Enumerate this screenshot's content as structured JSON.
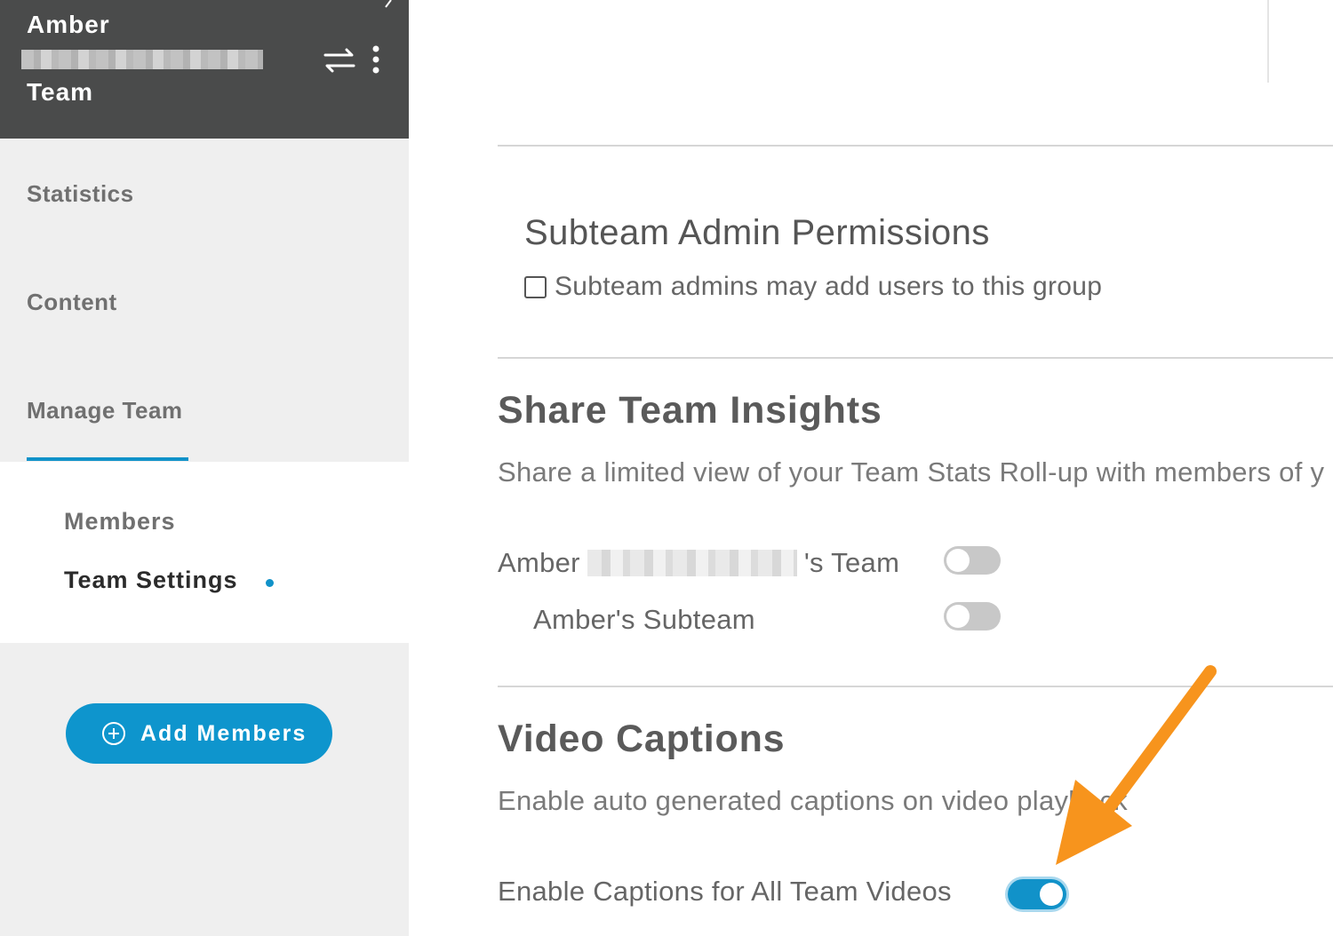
{
  "sidebar": {
    "team_name_line1": "Amber",
    "team_name_line2": "Team",
    "nav": {
      "statistics": "Statistics",
      "content": "Content",
      "manage_team": "Manage Team"
    },
    "subnav": {
      "members": "Members",
      "team_settings": "Team Settings"
    },
    "add_members_label": "Add Members",
    "accent_color": "#1192c9",
    "header_color": "#4a4b4b"
  },
  "main": {
    "subteam_admin": {
      "title": "Subteam Admin Permissions",
      "checkbox_label": "Subteam admins may add users to this group",
      "checked": false
    },
    "share_insights": {
      "title": "Share Team Insights",
      "description": "Share a limited view of your Team Stats Roll-up with members of y",
      "team_toggle": {
        "label_prefix": "Amber",
        "label_suffix": "'s Team",
        "on": false
      },
      "subteam_toggle": {
        "label": "Amber's Subteam",
        "on": false
      }
    },
    "video_captions": {
      "title": "Video Captions",
      "description": "Enable auto generated captions on video playback",
      "toggle": {
        "label": "Enable Captions for All Team Videos",
        "on": true
      }
    },
    "annotation_color": "#f7941d"
  },
  "icons": {
    "switch": "swap-arrows-icon",
    "more": "vertical-dots-icon",
    "plus": "plus-circle-icon",
    "back": "chevron-left-icon"
  }
}
